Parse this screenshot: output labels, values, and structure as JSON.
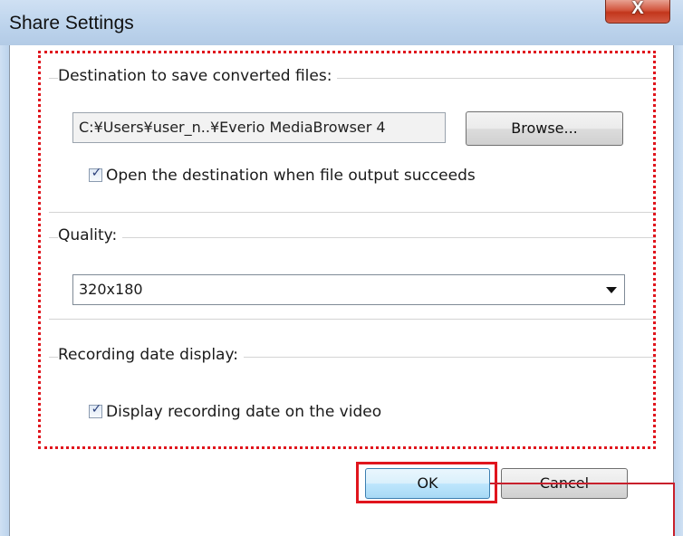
{
  "window": {
    "title": "Share Settings",
    "close_label": "X"
  },
  "destination": {
    "label": "Destination to save converted files:",
    "path_value": "C:¥Users¥user_n..¥Everio MediaBrowser 4",
    "browse_label": "Browse...",
    "open_checkbox_label": "Open the destination when file output succeeds",
    "open_checkbox_checked": true
  },
  "quality": {
    "label": "Quality:",
    "selected": "320x180"
  },
  "recording_date": {
    "label": "Recording date display:",
    "checkbox_label": "Display recording date on the video",
    "checkbox_checked": true
  },
  "buttons": {
    "ok_label": "OK",
    "cancel_label": "Cancel"
  },
  "colors": {
    "annotation_red": "#e0151d",
    "ok_border": "#3c7fb1"
  }
}
